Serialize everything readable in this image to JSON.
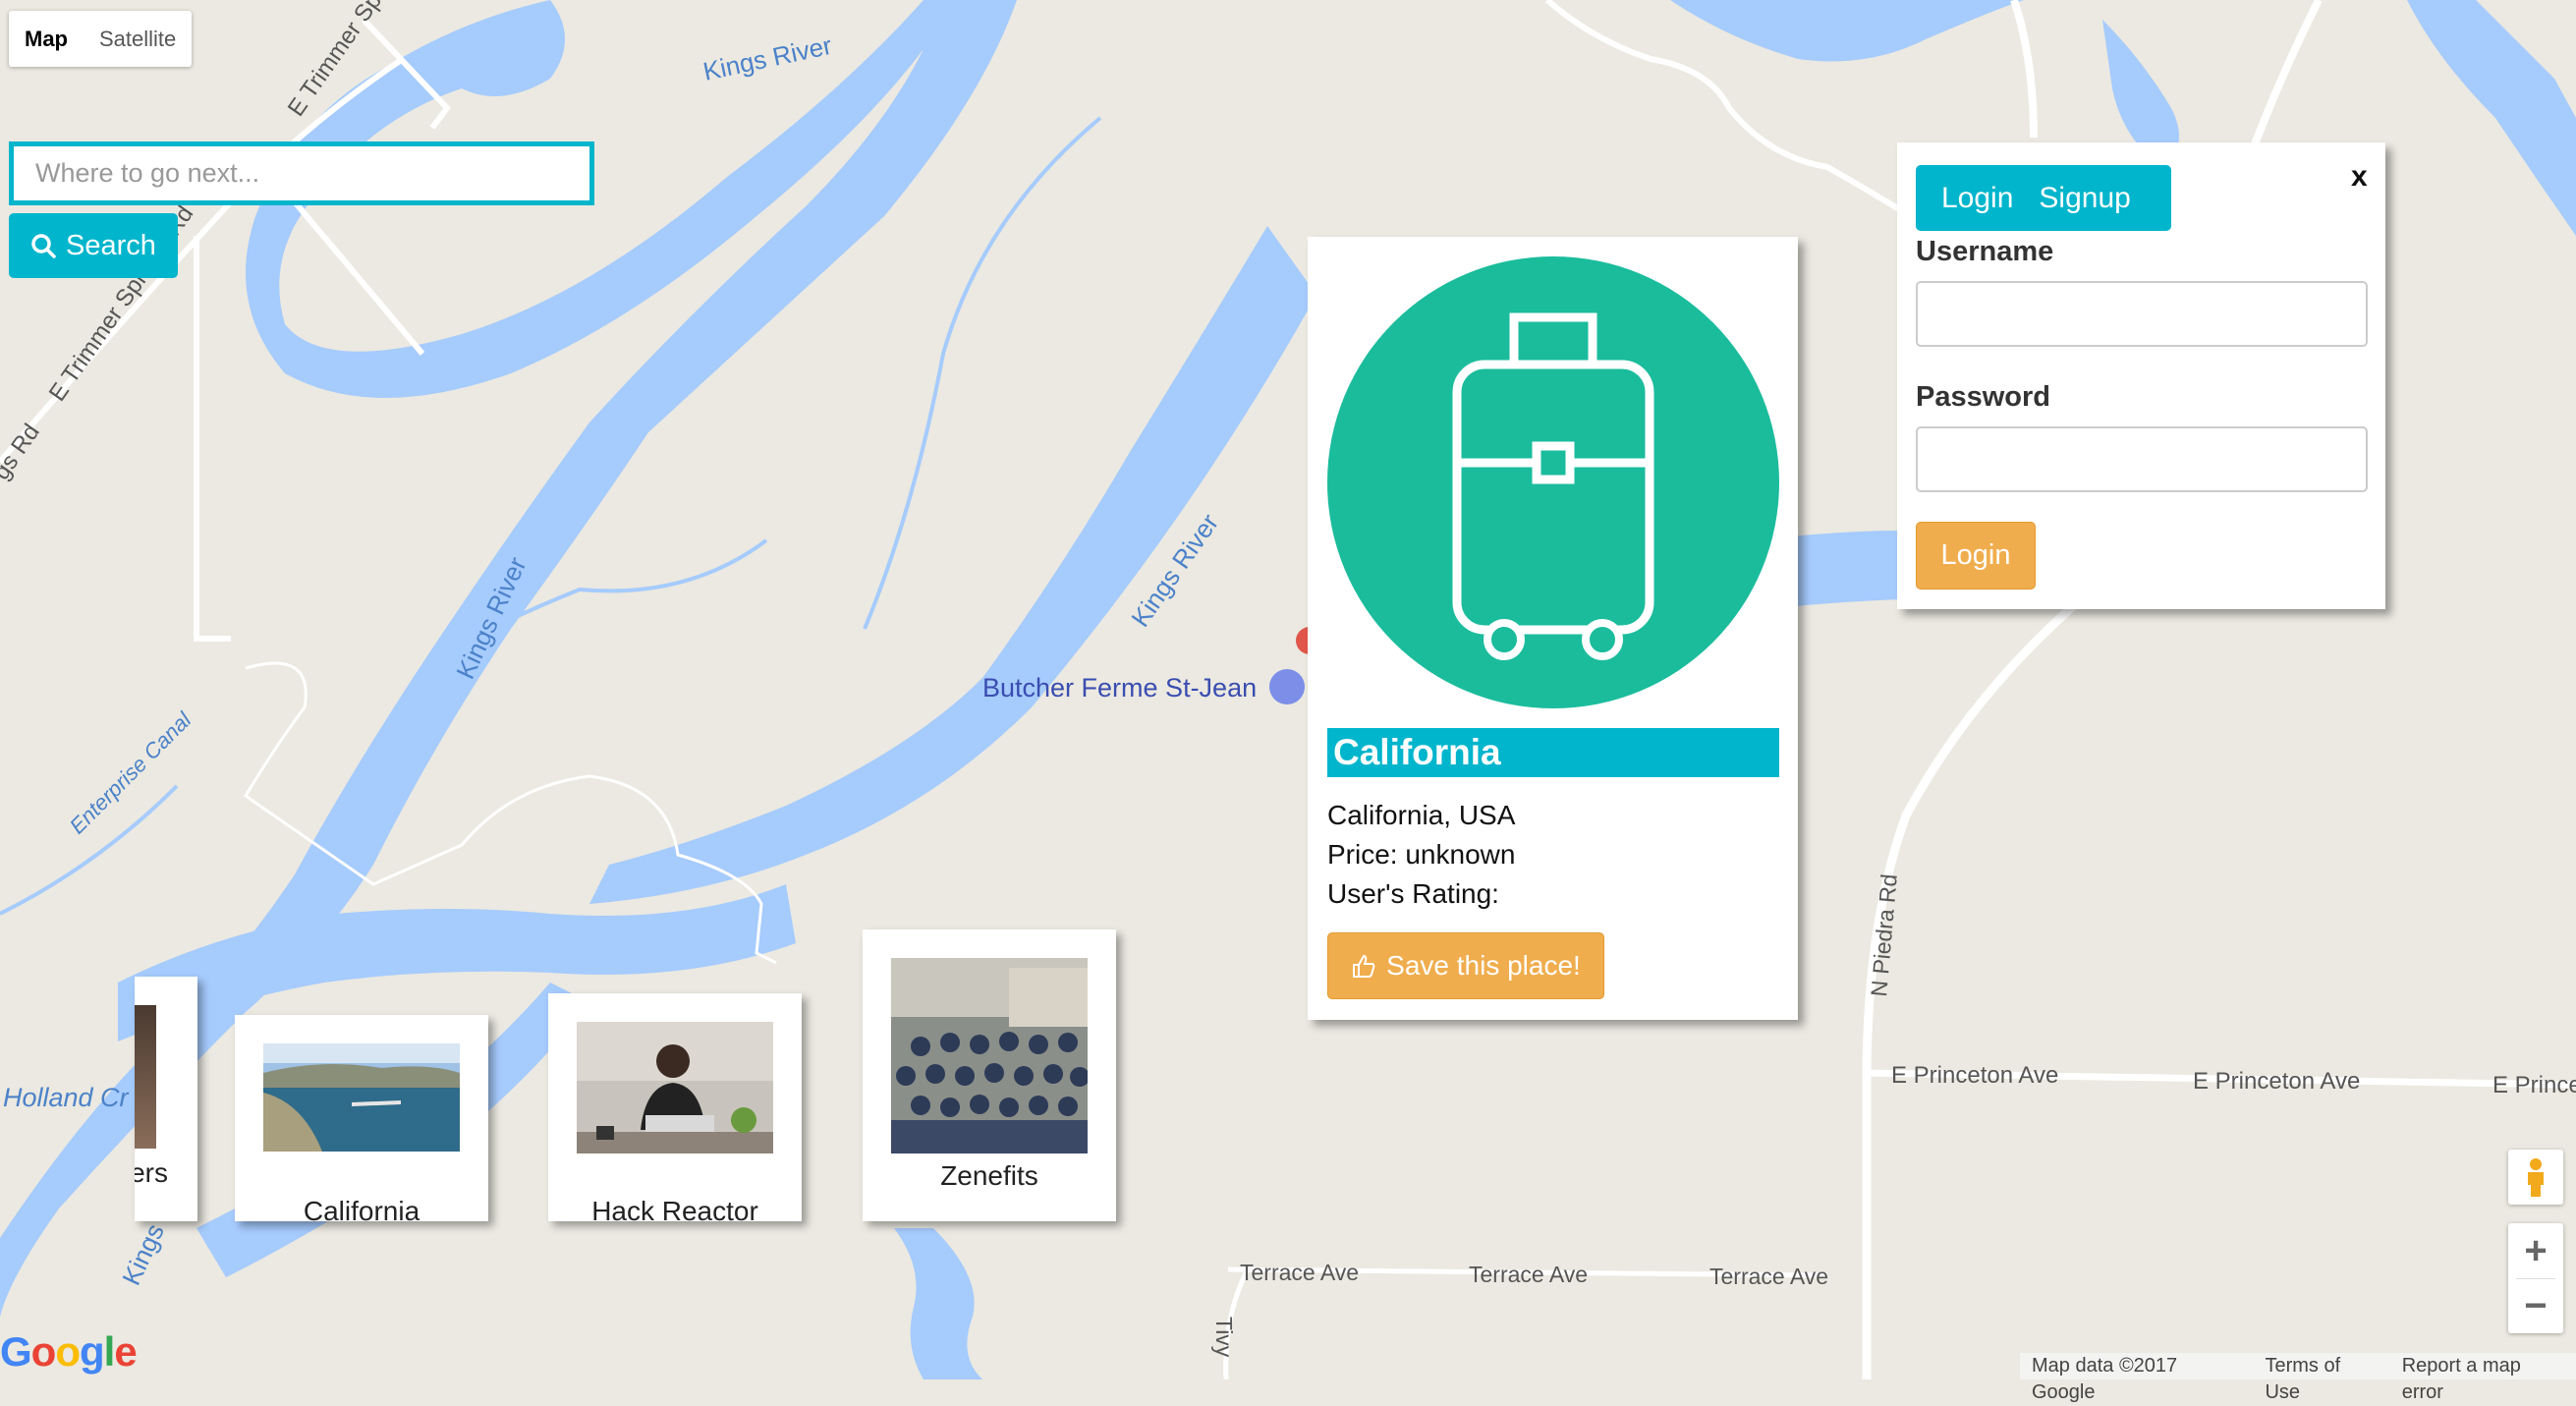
{
  "map": {
    "type_control": {
      "map_label": "Map",
      "satellite_label": "Satellite"
    },
    "labels": {
      "kings_river_top": "Kings River",
      "kings_river_mid": "Kings River",
      "kings_river_left": "Kings River",
      "kings_river_bottom": "Kings",
      "trimmer_road_1": "E Trimmer Sp",
      "trimmer_road_2": "E Trimmer Springs Rd",
      "gs_rd": "gs Rd",
      "enterprise_canal": "Enterprise Canal",
      "holland": "Holland Cr",
      "poi_butcher": "Butcher Ferme St-Jean",
      "n_piedra": "N Piedra Rd",
      "princeton_1": "E Princeton Ave",
      "princeton_2": "E Princeton Ave",
      "princeton_3": "E Prince",
      "terrace_1": "Terrace Ave",
      "terrace_2": "Terrace Ave",
      "terrace_3": "Terrace Ave",
      "tivy": "Tivy"
    },
    "attribution": {
      "data": "Map data ©2017 Google",
      "terms": "Terms of Use",
      "report": "Report a map error"
    },
    "zoom": {
      "in": "+",
      "out": "−"
    },
    "logo": "Google"
  },
  "search": {
    "placeholder": "Where to go next...",
    "button_label": "Search"
  },
  "cards": [
    {
      "label": "ers"
    },
    {
      "label": "California"
    },
    {
      "label": "Hack Reactor"
    },
    {
      "label": "Zenefits"
    }
  ],
  "detail": {
    "title": "California",
    "location": "California, USA",
    "price": "Price: unknown",
    "rating": "User's Rating:",
    "save_label": "Save this place!"
  },
  "auth": {
    "tab_login": "Login",
    "tab_signup": "Signup",
    "close": "x",
    "username_label": "Username",
    "password_label": "Password",
    "login_button": "Login"
  },
  "colors": {
    "accent": "#00b5cc",
    "warning": "#f0ad4e",
    "teal": "#1abc9c",
    "water": "#a6cbfd"
  }
}
